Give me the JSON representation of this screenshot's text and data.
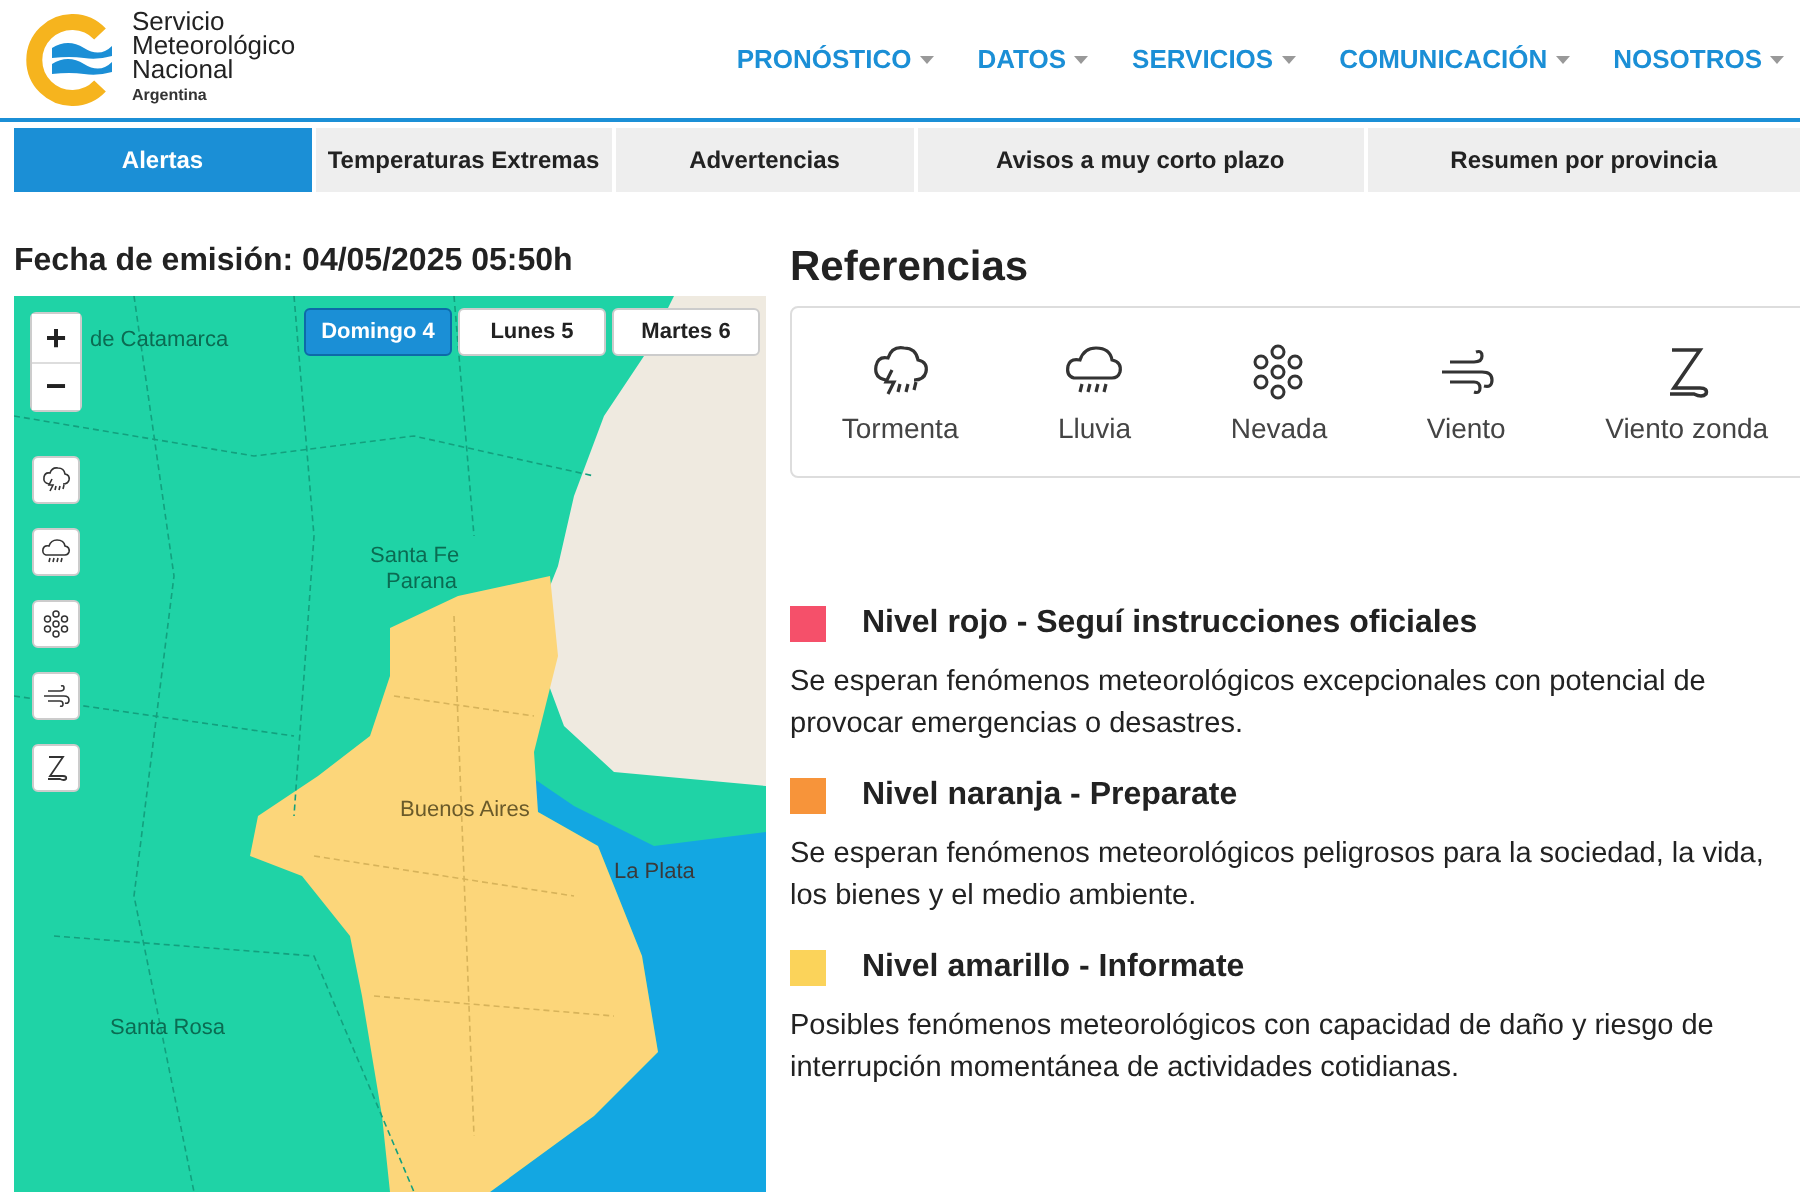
{
  "header": {
    "logo_lines": [
      "Servicio",
      "Meteorológico",
      "Nacional"
    ],
    "logo_country": "Argentina",
    "nav": [
      {
        "label": "PRONÓSTICO"
      },
      {
        "label": "DATOS"
      },
      {
        "label": "SERVICIOS"
      },
      {
        "label": "COMUNICACIÓN"
      },
      {
        "label": "NOSOTROS"
      }
    ]
  },
  "tabs": [
    {
      "label": "Alertas",
      "selected": true
    },
    {
      "label": "Temperaturas Extremas",
      "selected": false
    },
    {
      "label": "Advertencias",
      "selected": false
    },
    {
      "label": "Avisos a muy corto plazo",
      "selected": false
    },
    {
      "label": "Resumen por provincia",
      "selected": false
    }
  ],
  "emission": "Fecha de emisión: 04/05/2025 05:50h",
  "map": {
    "days": [
      {
        "label": "Domingo 4",
        "selected": true
      },
      {
        "label": "Lunes 5",
        "selected": false
      },
      {
        "label": "Martes 6",
        "selected": false
      }
    ],
    "zoom": [
      "+",
      "−"
    ],
    "layers": [
      {
        "kind": "storm"
      },
      {
        "kind": "rain"
      },
      {
        "kind": "snow"
      },
      {
        "kind": "wind"
      },
      {
        "kind": "zonda"
      }
    ],
    "places": [
      "de Catamarca",
      "Santa Fe",
      "Parana",
      "Buenos Aires",
      "La Plata",
      "Santa Rosa"
    ]
  },
  "references": {
    "title": "Referencias",
    "items": [
      {
        "kind": "storm",
        "label": "Tormenta"
      },
      {
        "kind": "rain",
        "label": "Lluvia"
      },
      {
        "kind": "snow",
        "label": "Nevada"
      },
      {
        "kind": "wind",
        "label": "Viento"
      },
      {
        "kind": "zonda",
        "label": "Viento zonda"
      }
    ]
  },
  "levels": [
    {
      "title": "Nivel rojo - Seguí instrucciones oficiales",
      "color": "#f5506a",
      "description": "Se esperan fenómenos meteorológicos excepcionales con potencial de provocar emergencias o desastres."
    },
    {
      "title": "Nivel naranja - Preparate",
      "color": "#f7943a",
      "description": "Se esperan fenómenos meteorológicos peligrosos para la sociedad, la vida, los bienes y el medio ambiente."
    },
    {
      "title": "Nivel amarillo - Informate",
      "color": "#fbd35a",
      "description": "Posibles fenómenos meteorológicos con capacidad de daño y riesgo de interrupción momentánea de actividades cotidianas."
    }
  ]
}
